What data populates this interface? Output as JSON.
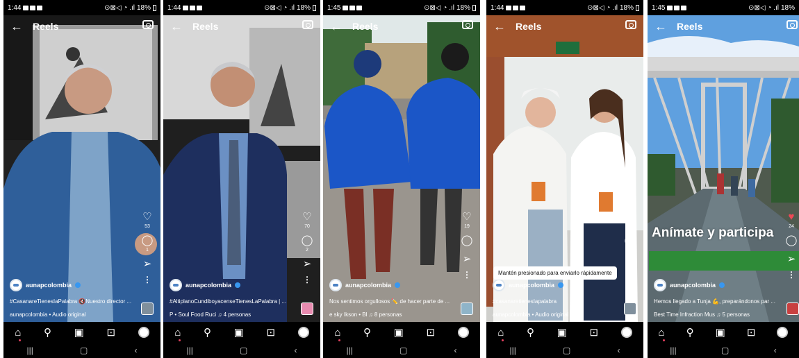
{
  "phones": [
    {
      "status": {
        "time": "1:44",
        "battery": "18%"
      },
      "header": {
        "title": "Reels"
      },
      "actions": {
        "likes": "53",
        "comments": "1"
      },
      "author": {
        "username": "aunapcolombia"
      },
      "caption": "#CasanareTienesIaPalabra 🔇Nuestro director ...",
      "audio": "aunapcolombia • Audio original"
    },
    {
      "status": {
        "time": "1:44",
        "battery": "18%"
      },
      "header": {
        "title": "Reels"
      },
      "actions": {
        "likes": "70",
        "comments": "2"
      },
      "author": {
        "username": "aunapcolombia"
      },
      "caption": "#AltiplanoCundiboyacenseTienesLaPalabra | ...",
      "audio": "P • Soul Food  Ruci  ♫ 4 personas"
    },
    {
      "status": {
        "time": "1:45",
        "battery": "18%"
      },
      "header": {
        "title": "Reels"
      },
      "actions": {
        "likes": "19",
        "comments": ""
      },
      "author": {
        "username": "aunapcolombia"
      },
      "caption": "Nos sentimos orgullosos ✏️ de hacer parte de ...",
      "audio": "e sky  Ikson • Bl  ♫ 8 personas"
    },
    {
      "status": {
        "time": "1:44",
        "battery": "18%"
      },
      "header": {
        "title": "Reels"
      },
      "actions": {
        "likes": "33",
        "comments": ""
      },
      "author": {
        "username": "aunapcolombia"
      },
      "caption": "#casanaretienesIapalabra",
      "audio": "aunapcolombia • Audio original",
      "tooltip": "Mantén presionado para enviarlo rápidamente"
    },
    {
      "status": {
        "time": "1:45",
        "battery": "18%"
      },
      "header": {
        "title": "Reels"
      },
      "actions": {
        "likes": "24",
        "comments": ""
      },
      "author": {
        "username": "aunapcolombia"
      },
      "caption": "Hemos llegado a Tunja 💪, preparándonos par ...",
      "audio": "Best Time  Infraction Mus  ♫ 5 personas",
      "overlay_text": "Anímate y participa"
    }
  ],
  "icons": {
    "back": "back-arrow-icon",
    "camera": "camera-icon",
    "like": "heart-icon",
    "comment": "comment-icon",
    "share": "send-icon",
    "more": "more-icon",
    "nav": [
      "home-icon",
      "search-icon",
      "reels-icon",
      "shop-icon",
      "profile-icon"
    ]
  }
}
